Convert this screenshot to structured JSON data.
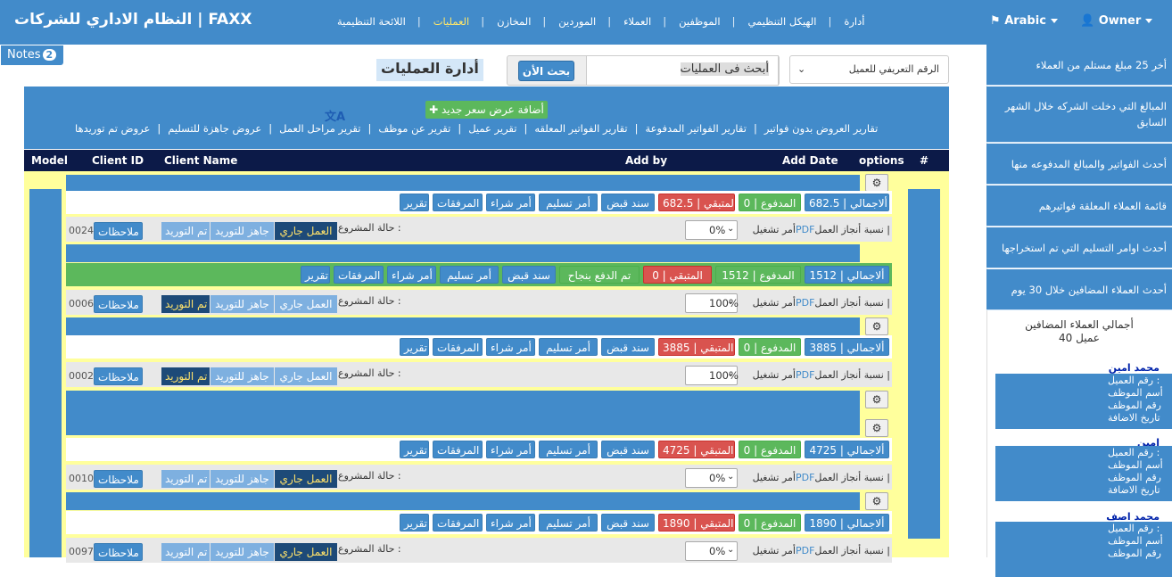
{
  "header": {
    "brand": "النظام الاداري للشركات | FAXX",
    "nav": [
      "أدارة",
      "الهيكل التنظيمي",
      "الموظفين",
      "العملاء",
      "الموردين",
      "المخازن",
      "العمليات",
      "اللائحة التنظيمية"
    ],
    "active_nav": "العمليات",
    "language": "Arabic",
    "user": "Owner"
  },
  "notes": {
    "label": "Notes",
    "count": "2"
  },
  "main": {
    "title": "أدارة العمليات",
    "search_button": "بحث الأن",
    "search_value": "أبحث فى العمليات",
    "select_value": "الرقم التعريفي للعميل",
    "add_button": "أضافة عرض سعر جديد",
    "reports": [
      "تقارير العروض بدون فواتير",
      "تقارير الفواتير المدفوعة",
      "تقارير الفواتير المعلقه",
      "تقرير عميل",
      "تقرير عن موظف",
      "تقرير مراحل العمل",
      "عروض جاهزة للتسليم",
      "عروض تم توريدها"
    ]
  },
  "table": {
    "columns": [
      "#",
      "options",
      "Add Date",
      "Add by",
      "Client Name",
      "Client ID",
      "Model"
    ]
  },
  "labels": {
    "total": "ألاجمالي",
    "paid": "المدفوع",
    "remain": "المتبقي",
    "receipt": "سند قبض",
    "delivery": "أمر تسليم",
    "purchase": "أمر شراء",
    "attachments": "المرفقات",
    "report": "تقرير",
    "paid_ok": "تم الدفع بنجاح",
    "run_order": "أمر تشغيل",
    "pdf": "PDF",
    "progress": "نسبة أنجاز العمل",
    "status": "حالة المشروع :",
    "running": "العمل جاري",
    "ready": "جاهز للتوريد",
    "supplied": "تم التوريد",
    "notes": "ملاحظات"
  },
  "records": [
    {
      "total": "682.5",
      "paid": "0",
      "remain": "682.5",
      "progress": "0%",
      "id": "0024",
      "state": "running",
      "fully_paid": false
    },
    {
      "total": "1512",
      "paid": "1512",
      "remain": "0",
      "progress": "100%",
      "id": "0006",
      "state": "supplied",
      "fully_paid": true
    },
    {
      "total": "3885",
      "paid": "0",
      "remain": "3885",
      "progress": "100%",
      "id": "0002",
      "state": "supplied",
      "fully_paid": false
    },
    {
      "total": "4725",
      "paid": "0",
      "remain": "4725",
      "progress": "0%",
      "id": "0010",
      "state": "running",
      "fully_paid": false
    },
    {
      "total": "1890",
      "paid": "0",
      "remain": "1890",
      "progress": "0%",
      "id": "0097",
      "state": "running",
      "fully_paid": false
    }
  ],
  "sidebar": {
    "items": [
      "أخر 25 مبلغ مستلم من العملاء",
      "المبالغ التي دخلت الشركه خلال الشهر السابق",
      "أحدث الفواتير والمبالغ المدفوعه منها",
      "قائمة العملاء المعلقة فواتيرهم",
      "أحدث اوامر التسليم التي تم استخراجها",
      "أحدث العملاء المضافين خلال 30 يوم"
    ],
    "total_title": "أجمالي العملاء المضافين",
    "total_count": "عميل 40",
    "customers": [
      {
        "name": "محمد امين",
        "lines": [
          "رقم العميل :",
          "أسم الموظف",
          "رقم الموظف",
          "تاريخ الاضافة"
        ]
      },
      {
        "name": "امين",
        "lines": [
          "رقم العميل :",
          "أسم الموظف",
          "رقم الموظف",
          "تاريخ الاضافة"
        ]
      },
      {
        "name": "محمد اصف",
        "lines": [
          "رقم العميل :",
          "أسم الموظف",
          "رقم الموظف"
        ]
      }
    ]
  }
}
